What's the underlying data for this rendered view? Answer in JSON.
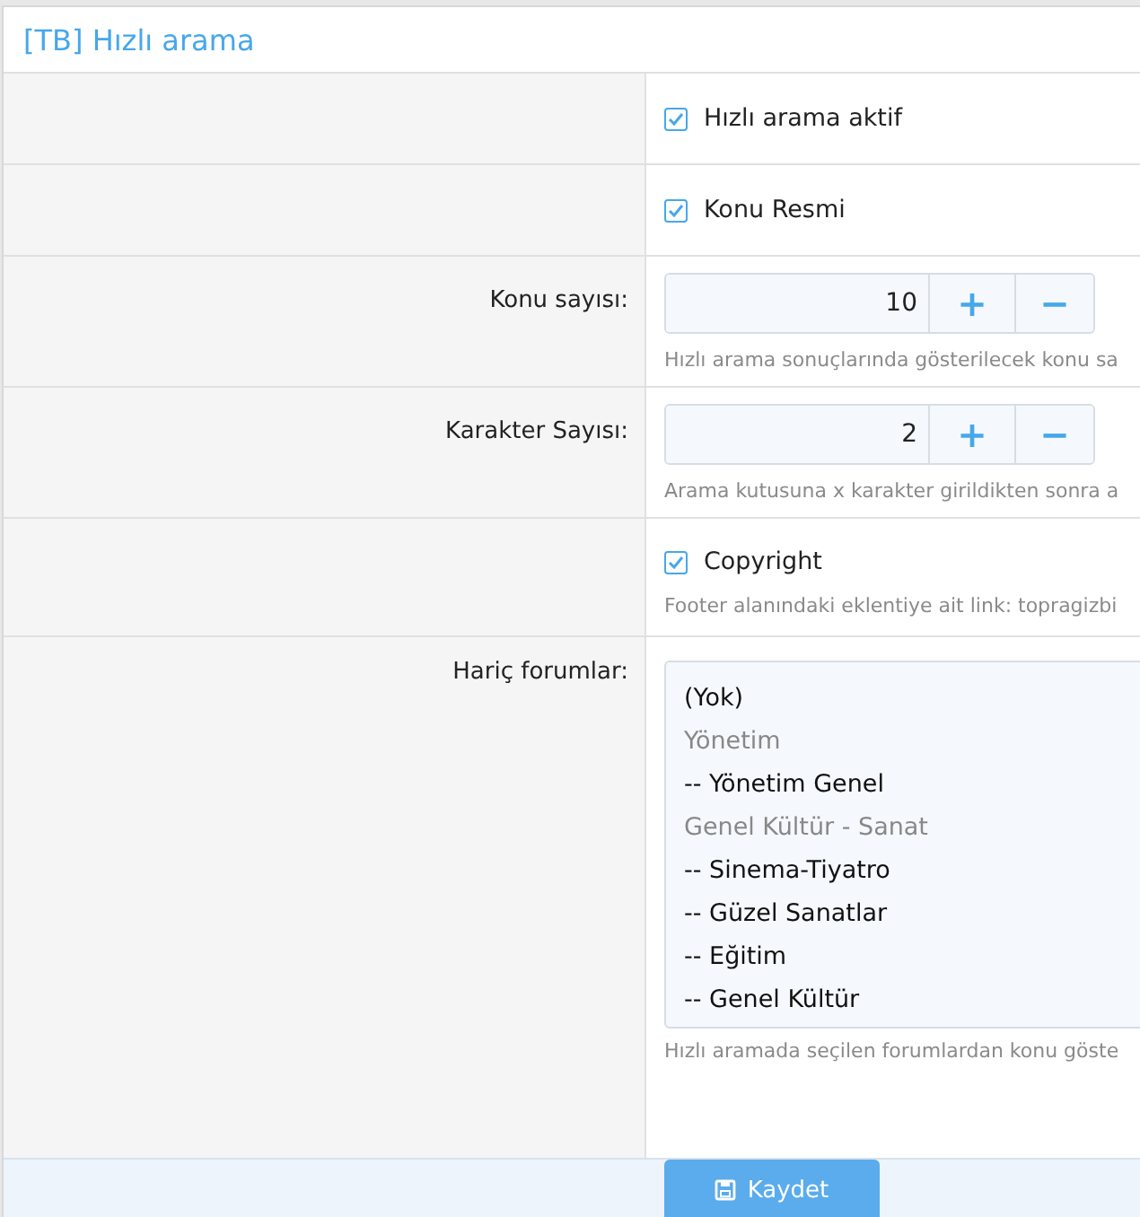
{
  "title": "[TB] Hızlı arama",
  "rows": [
    {
      "kind": "checkbox",
      "label": "Hızlı arama aktif",
      "checked": true
    },
    {
      "kind": "checkbox",
      "label": "Konu Resmi",
      "checked": true
    },
    {
      "kind": "number",
      "title": "Konu sayısı:",
      "value": "10",
      "plus": "+",
      "minus": "−",
      "hint": "Hızlı arama sonuçlarında gösterilecek konu sa"
    },
    {
      "kind": "number",
      "title": "Karakter Sayısı:",
      "value": "2",
      "plus": "+",
      "minus": "−",
      "hint": "Arama kutusuna x karakter girildikten sonra a"
    },
    {
      "kind": "checkbox",
      "label": "Copyright",
      "checked": true,
      "hint": "Footer alanındaki eklentiye ait link: topragizbi"
    },
    {
      "kind": "list",
      "title": "Hariç forumlar:",
      "hint": "Hızlı aramada seçilen forumlardan konu göste",
      "options": [
        {
          "label": "(Yok)",
          "kind": "option"
        },
        {
          "label": "Yönetim",
          "kind": "group"
        },
        {
          "label": "-- Yönetim Genel",
          "kind": "option"
        },
        {
          "label": "Genel Kültür - Sanat",
          "kind": "group"
        },
        {
          "label": "-- Sinema-Tiyatro",
          "kind": "option"
        },
        {
          "label": "-- Güzel Sanatlar",
          "kind": "option"
        },
        {
          "label": "-- Eğitim",
          "kind": "option"
        },
        {
          "label": "-- Genel Kültür",
          "kind": "option"
        }
      ]
    }
  ],
  "save": "Kaydet"
}
